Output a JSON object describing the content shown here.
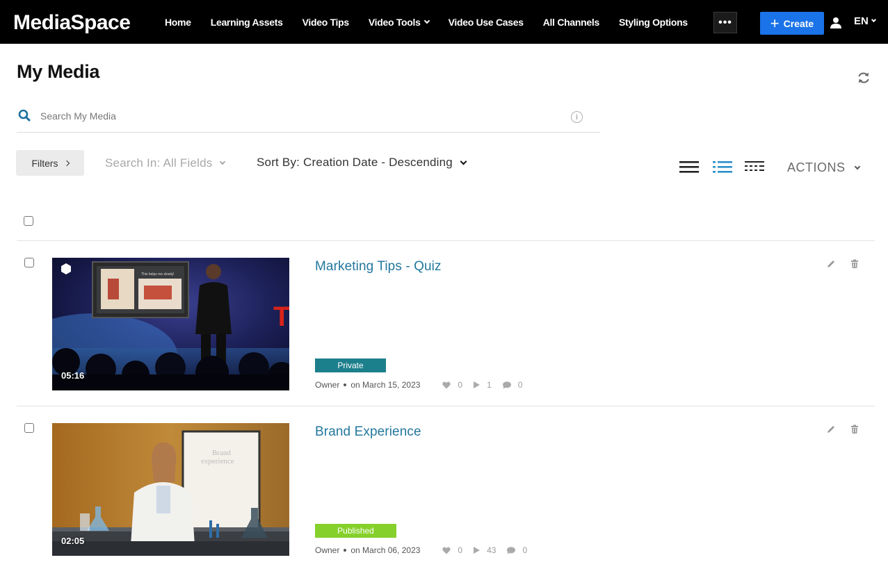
{
  "app": {
    "brand": "MediaSpace"
  },
  "nav": {
    "items": [
      "Home",
      "Learning Assets",
      "Video Tips",
      "Video Tools",
      "Video Use Cases",
      "All Channels",
      "Styling Options"
    ],
    "more_label": "•••",
    "create_label": "Create",
    "language": "EN"
  },
  "page": {
    "title": "My Media"
  },
  "search": {
    "placeholder": "Search My Media",
    "value": ""
  },
  "toolbar": {
    "filters_label": "Filters",
    "search_in_label": "Search In: All Fields",
    "sort_by_label": "Sort By: Creation Date - Descending",
    "actions_label": "ACTIONS"
  },
  "entries": [
    {
      "title": "Marketing Tips - Quiz",
      "duration": "05:16",
      "status": "Private",
      "owner": "Owner",
      "date": "on March 15, 2023",
      "likes": "0",
      "plays": "1",
      "comments": "0"
    },
    {
      "title": "Brand Experience",
      "duration": "02:05",
      "status": "Published",
      "owner": "Owner",
      "date": "on March 06, 2023",
      "likes": "0",
      "plays": "43",
      "comments": "0"
    }
  ],
  "thumbnails": [
    {
      "slide_text": "This helps me slowly!",
      "stage_text": "TE"
    },
    {
      "board_text_1": "Brand",
      "board_text_2": "experience"
    }
  ],
  "colors": {
    "accent": "#1a73e8",
    "link": "#23779d",
    "private_badge": "#1c7f8c",
    "published_badge": "#86d02b",
    "topbar": "#000000"
  },
  "icons": {
    "search": "search-icon",
    "refresh": "refresh-icon",
    "user": "user-icon",
    "info": "info-icon",
    "edit": "pencil-icon",
    "delete": "trash-icon",
    "like": "heart-icon",
    "play": "play-icon",
    "comment": "comment-icon"
  }
}
